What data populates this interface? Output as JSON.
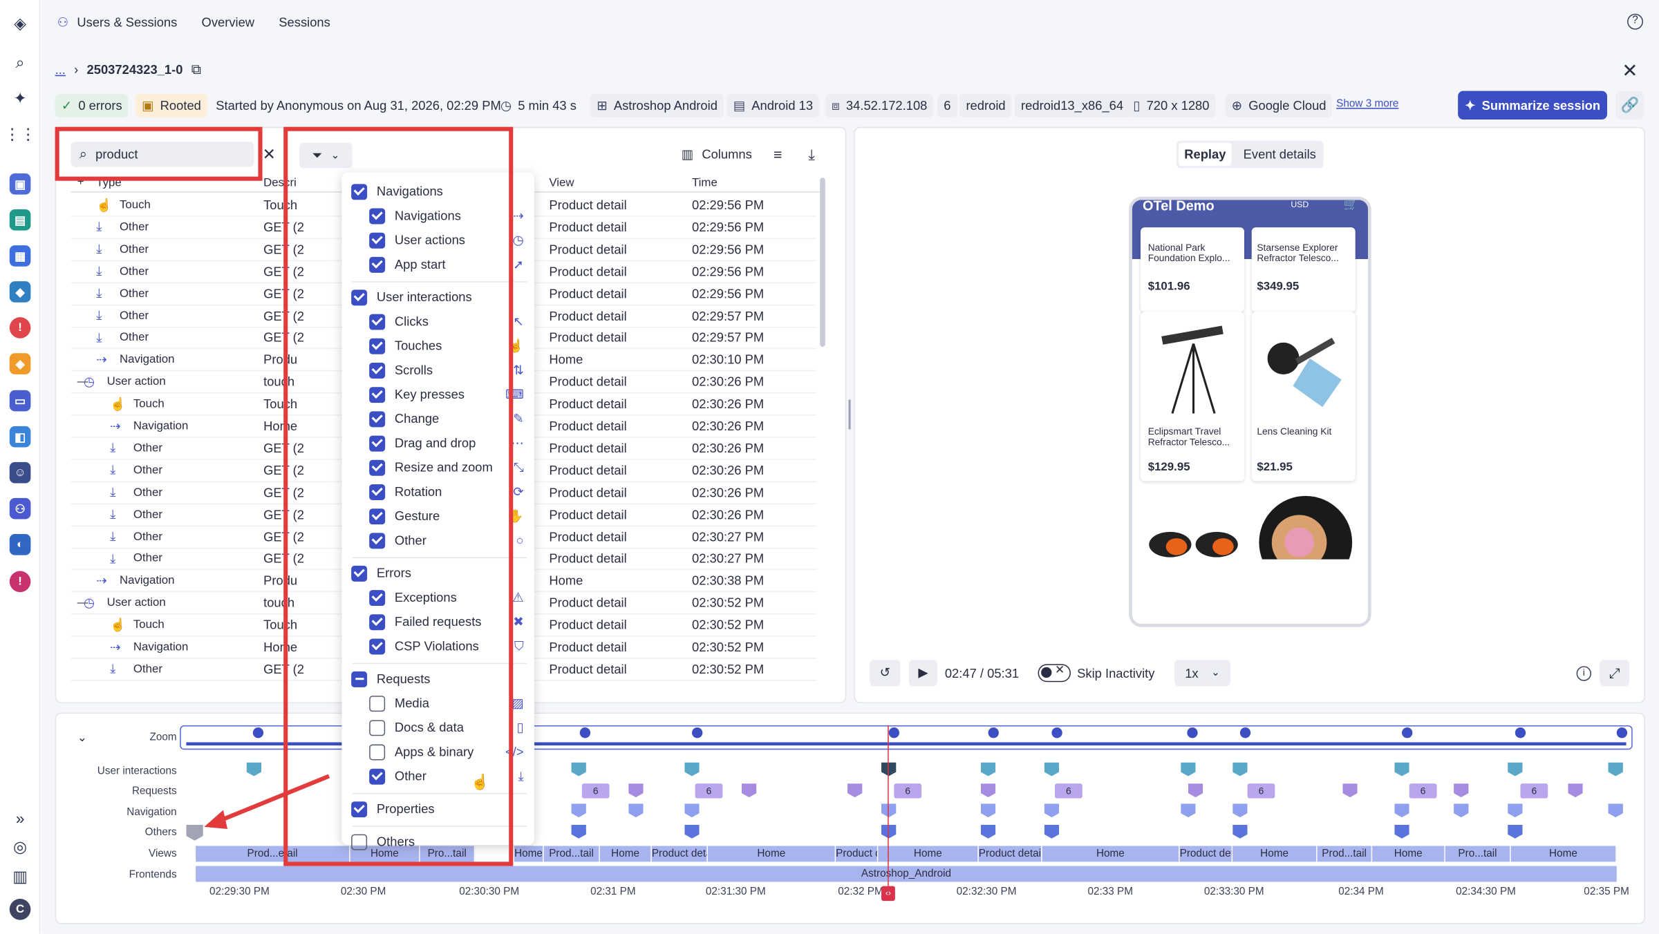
{
  "topbar": {
    "app": "Users & Sessions",
    "tabs": [
      "Overview",
      "Sessions"
    ],
    "help_icon": "help-icon"
  },
  "session": {
    "breadcrumb_dots": "...",
    "id": "2503724323_1-0",
    "errors": "0 errors",
    "rooted": "Rooted",
    "started": "Started by Anonymous on Aug 31, 2026, 02:29 PM",
    "duration": "5 min 43 s",
    "app": "Astroshop Android",
    "os": "Android 13",
    "ip": "34.52.172.108",
    "count": "6",
    "device": "redroid",
    "device_model": "redroid13_x86_64",
    "resolution": "720 x 1280",
    "provider": "Google Cloud",
    "show_more": "Show 3 more",
    "summarize": "Summarize session"
  },
  "table": {
    "search_value": "product",
    "columns_label": "Columns",
    "headers": {
      "type": "Type",
      "description": "Descri",
      "view": "View",
      "time": "Time"
    },
    "rows": [
      {
        "type": "Touch",
        "desc": "Touch",
        "view": "Product detail",
        "time": "02:29:56 PM",
        "icon": "touch",
        "lvl": 1
      },
      {
        "type": "Other",
        "desc": "GET (2",
        "view": "Product detail",
        "time": "02:29:56 PM",
        "icon": "other",
        "lvl": 1
      },
      {
        "type": "Other",
        "desc": "GET (2",
        "view": "Product detail",
        "time": "02:29:56 PM",
        "icon": "other",
        "lvl": 1
      },
      {
        "type": "Other",
        "desc": "GET (2",
        "view": "Product detail",
        "time": "02:29:56 PM",
        "icon": "other",
        "lvl": 1
      },
      {
        "type": "Other",
        "desc": "GET (2",
        "view": "Product detail",
        "time": "02:29:56 PM",
        "icon": "other",
        "lvl": 1
      },
      {
        "type": "Other",
        "desc": "GET (2",
        "view": "Product detail",
        "time": "02:29:57 PM",
        "icon": "other",
        "lvl": 1
      },
      {
        "type": "Other",
        "desc": "GET (2",
        "view": "Product detail",
        "time": "02:29:57 PM",
        "icon": "other",
        "lvl": 1
      },
      {
        "type": "Navigation",
        "desc": "Produ",
        "view": "Home",
        "time": "02:30:10 PM",
        "icon": "nav",
        "lvl": 1
      },
      {
        "type": "User action",
        "desc": "touch",
        "view": "Product detail",
        "time": "02:30:26 PM",
        "icon": "action",
        "lvl": 0
      },
      {
        "type": "Touch",
        "desc": "Touch",
        "view": "Product detail",
        "time": "02:30:26 PM",
        "icon": "touch",
        "lvl": 2
      },
      {
        "type": "Navigation",
        "desc": "Home",
        "view": "Product detail",
        "time": "02:30:26 PM",
        "icon": "nav",
        "lvl": 2
      },
      {
        "type": "Other",
        "desc": "GET (2",
        "view": "Product detail",
        "time": "02:30:26 PM",
        "icon": "other",
        "lvl": 2
      },
      {
        "type": "Other",
        "desc": "GET (2",
        "view": "Product detail",
        "time": "02:30:26 PM",
        "icon": "other",
        "lvl": 2
      },
      {
        "type": "Other",
        "desc": "GET (2",
        "view": "Product detail",
        "time": "02:30:26 PM",
        "icon": "other",
        "lvl": 2
      },
      {
        "type": "Other",
        "desc": "GET (2",
        "view": "Product detail",
        "time": "02:30:26 PM",
        "icon": "other",
        "lvl": 2
      },
      {
        "type": "Other",
        "desc": "GET (2",
        "view": "Product detail",
        "time": "02:30:27 PM",
        "icon": "other",
        "lvl": 2
      },
      {
        "type": "Other",
        "desc": "GET (2",
        "view": "Product detail",
        "time": "02:30:27 PM",
        "icon": "other",
        "lvl": 2
      },
      {
        "type": "Navigation",
        "desc": "Produ",
        "view": "Home",
        "time": "02:30:38 PM",
        "icon": "nav",
        "lvl": 1
      },
      {
        "type": "User action",
        "desc": "touch",
        "view": "Product detail",
        "time": "02:30:52 PM",
        "icon": "action",
        "lvl": 0
      },
      {
        "type": "Touch",
        "desc": "Touch",
        "view": "Product detail",
        "time": "02:30:52 PM",
        "icon": "touch",
        "lvl": 2
      },
      {
        "type": "Navigation",
        "desc": "Home",
        "view": "Product detail",
        "time": "02:30:52 PM",
        "icon": "nav",
        "lvl": 2
      },
      {
        "type": "Other",
        "desc": "GET (2",
        "view": "Product detail",
        "time": "02:30:52 PM",
        "icon": "other",
        "lvl": 2
      }
    ]
  },
  "filter": {
    "groups": [
      {
        "label": "Navigations",
        "state": "on",
        "items": [
          {
            "label": "Navigations",
            "on": true,
            "icon": "⇢"
          },
          {
            "label": "User actions",
            "on": true,
            "icon": "◷"
          },
          {
            "label": "App start",
            "on": true,
            "icon": "➚"
          }
        ]
      },
      {
        "label": "User interactions",
        "state": "on",
        "items": [
          {
            "label": "Clicks",
            "on": true,
            "icon": "↖"
          },
          {
            "label": "Touches",
            "on": true,
            "icon": "☝"
          },
          {
            "label": "Scrolls",
            "on": true,
            "icon": "⇅"
          },
          {
            "label": "Key presses",
            "on": true,
            "icon": "⌨"
          },
          {
            "label": "Change",
            "on": true,
            "icon": "✎"
          },
          {
            "label": "Drag and drop",
            "on": true,
            "icon": "⋯"
          },
          {
            "label": "Resize and zoom",
            "on": true,
            "icon": "⤡"
          },
          {
            "label": "Rotation",
            "on": true,
            "icon": "⟳"
          },
          {
            "label": "Gesture",
            "on": true,
            "icon": "✋"
          },
          {
            "label": "Other",
            "on": true,
            "icon": "○"
          }
        ]
      },
      {
        "label": "Errors",
        "state": "on",
        "items": [
          {
            "label": "Exceptions",
            "on": true,
            "icon": "⚠"
          },
          {
            "label": "Failed requests",
            "on": true,
            "icon": "✖"
          },
          {
            "label": "CSP Violations",
            "on": true,
            "icon": "⛉"
          }
        ]
      },
      {
        "label": "Requests",
        "state": "ind",
        "items": [
          {
            "label": "Media",
            "on": false,
            "icon": "▨"
          },
          {
            "label": "Docs & data",
            "on": false,
            "icon": "▯"
          },
          {
            "label": "Apps & binary",
            "on": false,
            "icon": "</>"
          },
          {
            "label": "Other",
            "on": true,
            "icon": "⤓"
          }
        ]
      },
      {
        "label": "Properties",
        "state": "on",
        "items": []
      },
      {
        "label": "Others",
        "state": "off",
        "items": []
      }
    ]
  },
  "replay": {
    "tabs": [
      "Replay",
      "Event details"
    ],
    "app_title": "OTel Demo",
    "currency": "USD",
    "products": [
      {
        "name": "National Park Foundation Explo...",
        "price": "$101.96"
      },
      {
        "name": "Starsense Explorer Refractor Telesco...",
        "price": "$349.95"
      },
      {
        "name": "Eclipsmart Travel Refractor Telesco...",
        "price": "$129.95"
      },
      {
        "name": "Lens Cleaning Kit",
        "price": "$21.95"
      }
    ],
    "time": "02:47 / 05:31",
    "skip": "Skip Inactivity",
    "speed": "1x"
  },
  "timeline": {
    "zoom": "Zoom",
    "rows": [
      "User interactions",
      "Requests",
      "Navigation",
      "Others",
      "Views",
      "Frontends"
    ],
    "views": [
      "Prod...etail",
      "Home",
      "Pro...tail",
      "Home",
      "Prod...tail",
      "Home",
      "Product detail",
      "Home",
      "Product detail",
      "Home",
      "Product detail",
      "Home",
      "Product detail",
      "Home",
      "Prod...tail",
      "Home",
      "Pro...tail",
      "Home"
    ],
    "frontend": "Astroshop_Android",
    "badges": [
      "6",
      "6",
      "6",
      "6",
      "6",
      "6",
      "6"
    ],
    "ticks": [
      "02:29:30 PM",
      "02:30 PM",
      "02:30:30 PM",
      "02:31 PM",
      "02:31:30 PM",
      "02:32 PM",
      "02:32:30 PM",
      "02:33 PM",
      "02:33:30 PM",
      "02:34 PM",
      "02:34:30 PM",
      "02:35 PM"
    ]
  }
}
